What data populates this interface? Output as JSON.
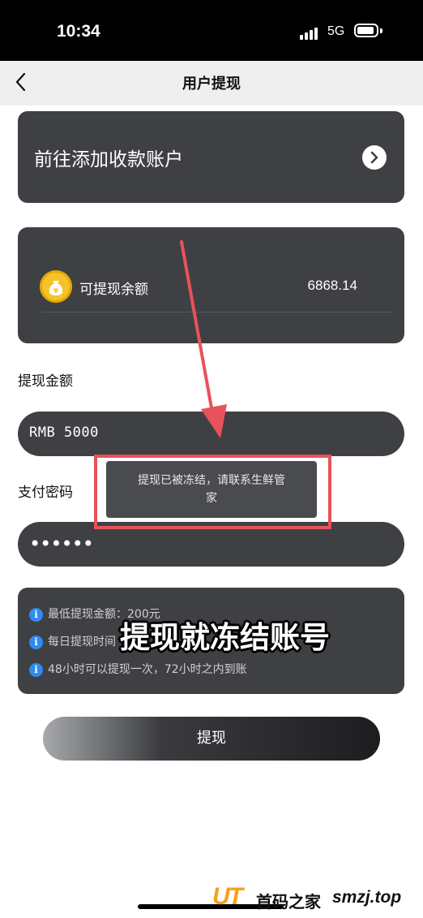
{
  "status_bar": {
    "time": "10:34",
    "network": "5G"
  },
  "nav": {
    "title": "用户提现",
    "back_icon": "chevron-left-icon"
  },
  "account_card": {
    "label": "前往添加收款账户",
    "chevron_icon": "chevron-right-circle-icon"
  },
  "balance_card": {
    "icon": "money-bag-icon",
    "label": "可提现余额",
    "value": "6868.14"
  },
  "amount_section": {
    "label": "提现金额",
    "value": "RMB 5000"
  },
  "password_section": {
    "label": "支付密码",
    "value": "••••••"
  },
  "toast": {
    "line1": "提现已被冻结，请联系生鲜管",
    "line2": "家"
  },
  "info": {
    "icon": "info-icon",
    "rows": [
      {
        "text": "最低提现金额：200元"
      },
      {
        "text": "每日提现时间"
      },
      {
        "text": "48小时可以提现一次，72小时之内到账"
      }
    ]
  },
  "overlay_caption": "提现就冻结账号",
  "submit_button": {
    "label": "提现"
  },
  "watermark": {
    "logo": "UT",
    "name": "首码之家",
    "url": "smzj.top"
  },
  "colors": {
    "card_bg": "#3f4043",
    "annotation_red": "#e8525a",
    "info_blue": "#2d8cf0",
    "coin_yellow": "#f6c22c"
  }
}
